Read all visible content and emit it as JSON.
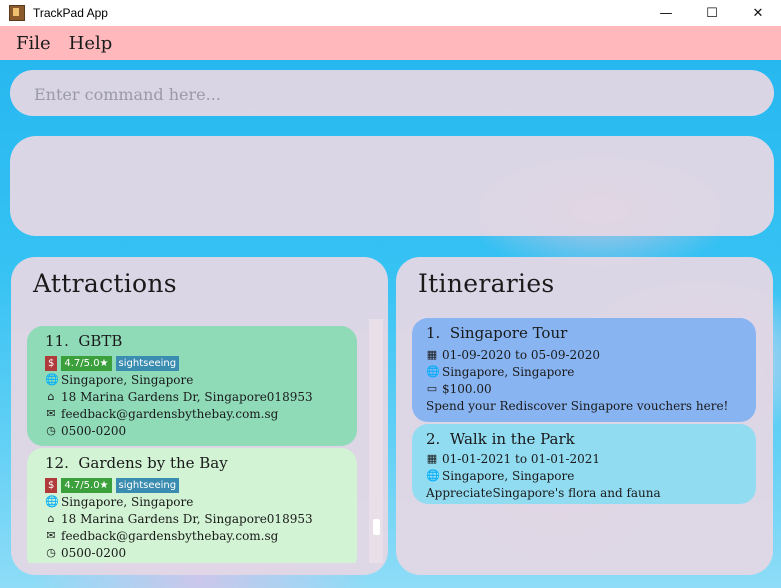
{
  "window": {
    "title": "TrackPad App",
    "controls": [
      "—",
      "☐",
      "✕"
    ]
  },
  "menu": {
    "file": "File",
    "help": "Help"
  },
  "command": {
    "placeholder": "Enter command here..."
  },
  "attractions": {
    "title": "Attractions",
    "items": [
      {
        "index": "11.",
        "name": "GBTB",
        "price": "$",
        "rating": "4.7/5.0★",
        "tag": "sightseeing",
        "location": "Singapore, Singapore",
        "address": "18 Marina Gardens Dr, Singapore018953",
        "email": "feedback@gardensbythebay.com.sg",
        "hours": "0500-0200",
        "color": "#8fdbb8"
      },
      {
        "index": "12.",
        "name": "Gardens by the Bay",
        "price": "$",
        "rating": "4.7/5.0★",
        "tag": "sightseeing",
        "location": "Singapore, Singapore",
        "address": "18 Marina Gardens Dr, Singapore018953",
        "email": "feedback@gardensbythebay.com.sg",
        "hours": "0500-0200",
        "color": "#d2f3d4"
      }
    ]
  },
  "itineraries": {
    "title": "Itineraries",
    "items": [
      {
        "index": "1.",
        "name": "Singapore Tour",
        "dates": "01-09-2020 to 05-09-2020",
        "location": "Singapore, Singapore",
        "budget": "$100.00",
        "description": "Spend your Rediscover Singapore vouchers here!",
        "color": "#89b4f2"
      },
      {
        "index": "2.",
        "name": "Walk in the Park",
        "dates": "01-01-2021 to 01-01-2021",
        "location": "Singapore, Singapore",
        "description": "AppreciateSingapore's flora and fauna",
        "color": "#92dcf2"
      }
    ]
  },
  "icons": {
    "globe": "🌐",
    "home": "⌂",
    "mail": "✉",
    "clock": "◷",
    "calendar": "▦",
    "money": "▭"
  }
}
